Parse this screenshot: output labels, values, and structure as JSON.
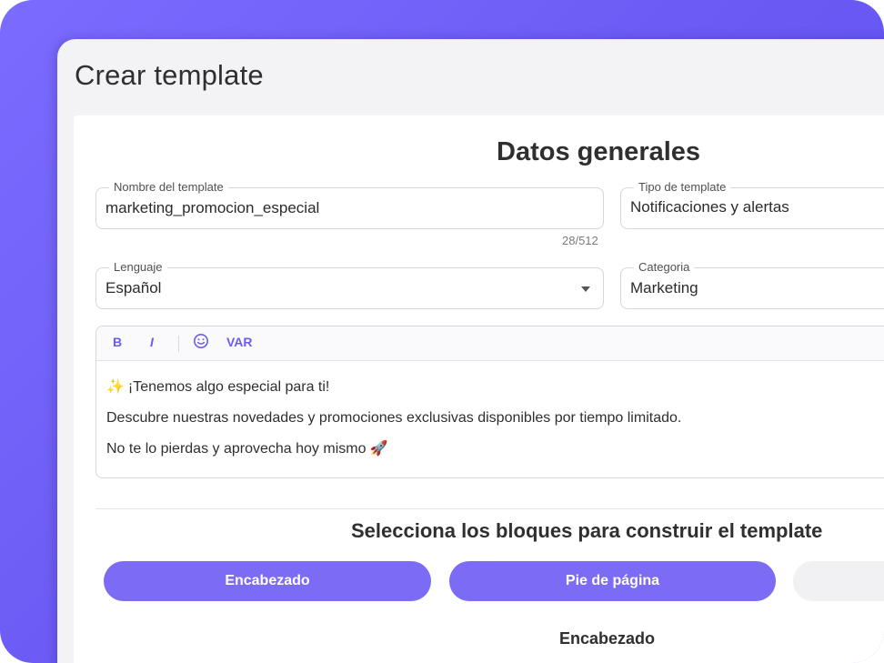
{
  "page": {
    "title": "Crear template"
  },
  "general": {
    "title": "Datos generales",
    "name_field": {
      "label": "Nombre del template",
      "value": "marketing_promocion_especial",
      "counter": "28/512"
    },
    "type_field": {
      "label": "Tipo de template",
      "value": "Notificaciones y alertas"
    },
    "language_field": {
      "label": "Lenguaje",
      "value": "Español"
    },
    "category_field": {
      "label": "Categoria",
      "value": "Marketing"
    }
  },
  "editor": {
    "toolbar": {
      "bold": "B",
      "italic": "I",
      "var": "VAR"
    },
    "lines": [
      {
        "emoji": "✨",
        "text": "¡Tenemos algo especial para ti!"
      },
      {
        "emoji": "",
        "text": "Descubre nuestras novedades y promociones exclusivas disponibles por tiempo limitado."
      },
      {
        "emoji": "🚀",
        "text": "No te lo pierdas y aprovecha hoy mismo"
      }
    ]
  },
  "blocks": {
    "title": "Selecciona los bloques para construir el template",
    "buttons": [
      {
        "label": "Encabezado"
      },
      {
        "label": "Pie de página"
      },
      {
        "label": ""
      }
    ],
    "section_heading": "Encabezado"
  },
  "colors": {
    "accent": "#7c6bf5",
    "frame": "#6c5cf5",
    "background": "#f3f3f6"
  }
}
